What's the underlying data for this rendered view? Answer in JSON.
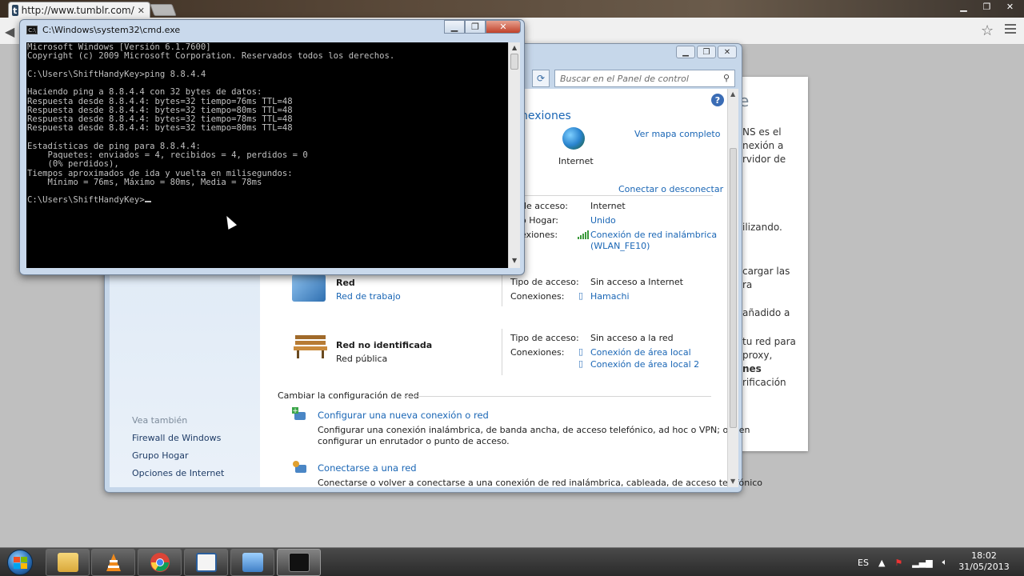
{
  "chrome": {
    "tab_title": "http://www.tumblr.com/",
    "tab_icon": "t",
    "tab_close": "✕"
  },
  "tumblr": {
    "lines": [
      "e",
      "NS es el",
      "nexión a",
      "rvidor de",
      "ilizando.",
      "cargar las",
      "ra",
      "añadido a",
      "tu red para",
      "proxy,",
      "nes",
      "rificación"
    ]
  },
  "net": {
    "search_placeholder": "Buscar en el Panel de control",
    "connections_title": "nexiones",
    "internet_label": "Internet",
    "ver_mapa": "Ver mapa completo",
    "conectar": "Conectar o desconectar",
    "help": "?",
    "net1": {
      "access_label": "de acceso:",
      "access_value": "Internet",
      "group_label": "o Hogar:",
      "group_value": "Unido",
      "conn_label": "exiones:",
      "conn_value_1": "Conexión de red inalámbrica",
      "conn_value_2": "(WLAN_FE10)"
    },
    "net2": {
      "name": "Red",
      "type": "Red de trabajo",
      "access_label": "Tipo de acceso:",
      "access_value": "Sin acceso a Internet",
      "conn_label": "Conexiones:",
      "conn_value": "Hamachi"
    },
    "net3": {
      "name": "Red no identificada",
      "type": "Red pública",
      "access_label": "Tipo de acceso:",
      "access_value": "Sin acceso a la red",
      "conn_label": "Conexiones:",
      "conn_value_1": "Conexión de área local",
      "conn_value_2": "Conexión de área local 2"
    },
    "change_settings": "Cambiar la configuración de red",
    "task1_link": "Configurar una nueva conexión o red",
    "task1_desc_1": "Configurar una conexión inalámbrica, de banda ancha, de acceso telefónico, ad hoc o VPN; o bien",
    "task1_desc_2": "configurar un enrutador o punto de acceso.",
    "task2_link": "Conectarse a una red",
    "task2_desc": "Conectarse o volver a conectarse a una conexión de red inalámbrica, cableada, de acceso telefónico",
    "see_also": "Vea también",
    "side_links": [
      "Firewall de Windows",
      "Grupo Hogar",
      "Opciones de Internet"
    ]
  },
  "cmd": {
    "title": "C:\\Windows\\system32\\cmd.exe",
    "icon_text": "C:\\",
    "lines": [
      "Microsoft Windows [Versión 6.1.7600]",
      "Copyright (c) 2009 Microsoft Corporation. Reservados todos los derechos.",
      "",
      "C:\\Users\\ShiftHandyKey>ping 8.8.4.4",
      "",
      "Haciendo ping a 8.8.4.4 con 32 bytes de datos:",
      "Respuesta desde 8.8.4.4: bytes=32 tiempo=76ms TTL=48",
      "Respuesta desde 8.8.4.4: bytes=32 tiempo=80ms TTL=48",
      "Respuesta desde 8.8.4.4: bytes=32 tiempo=78ms TTL=48",
      "Respuesta desde 8.8.4.4: bytes=32 tiempo=80ms TTL=48",
      "",
      "Estadísticas de ping para 8.8.4.4:",
      "    Paquetes: enviados = 4, recibidos = 4, perdidos = 0",
      "    (0% perdidos),",
      "Tiempos aproximados de ida y vuelta en milisegundos:",
      "    Mínimo = 76ms, Máximo = 80ms, Media = 78ms",
      ""
    ],
    "prompt": "C:\\Users\\ShiftHandyKey>"
  },
  "taskbar": {
    "lang": "ES",
    "time": "18:02",
    "date": "31/05/2013"
  },
  "colors": {
    "link": "#1a66b5",
    "cmd_bg": "#000000",
    "cmd_text": "#c0c0c0"
  }
}
